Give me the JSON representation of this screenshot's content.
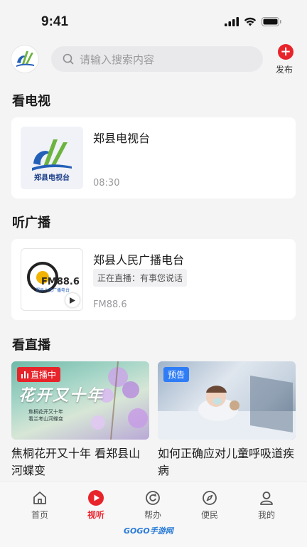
{
  "status": {
    "time": "9:41"
  },
  "header": {
    "search_placeholder": "请输入搜索内容",
    "publish_label": "发布"
  },
  "tv": {
    "section_title": "看电视",
    "channel_name": "郑县电视台",
    "logo_text": "郑县电视台",
    "time": "08:30"
  },
  "radio": {
    "section_title": "听广播",
    "channel_name": "郑县人民广播电台",
    "live_text": "正在直播：有事您说话",
    "logo_freq": "FM88.6",
    "logo_name": "郑县人民广播电台",
    "frequency": "FM88.6"
  },
  "live": {
    "section_title": "看直播",
    "items": [
      {
        "badge": "直播中",
        "title": "焦桐花开又十年 看郑县山河蝶变",
        "overlay_big": "花开又十年",
        "overlay_small": "焦桐花开又十年\n看兰考山河蝶变"
      },
      {
        "badge": "预告",
        "title": "如何正确应对儿童呼吸道疾病"
      }
    ]
  },
  "tabs": [
    {
      "label": "首页",
      "icon": "home-icon"
    },
    {
      "label": "视听",
      "icon": "play-icon",
      "active": true
    },
    {
      "label": "帮办",
      "icon": "refresh-icon"
    },
    {
      "label": "便民",
      "icon": "compass-icon"
    },
    {
      "label": "我的",
      "icon": "user-icon"
    }
  ],
  "watermark": "GOGO手游网",
  "colors": {
    "accent": "#e8242b",
    "live_badge": "#e8242b",
    "preview_badge": "#2f7df6"
  }
}
